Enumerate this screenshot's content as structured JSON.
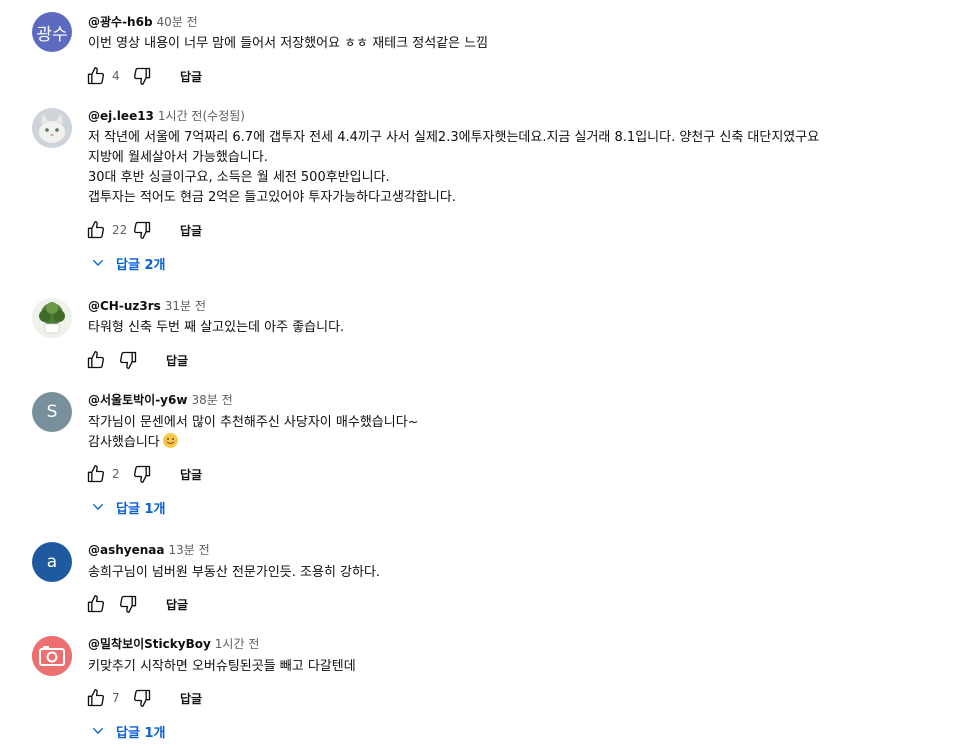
{
  "comments": [
    {
      "author": "@광수-h6b",
      "time": "40분 전",
      "avatar_text": "광수",
      "avatar_color": "#5c6bc0",
      "lines": [
        "이번 영상 내용이 너무 맘에 들어서 저장했어요 ㅎㅎ 재테크 정석같은 느낌"
      ],
      "likes": "4",
      "reply_label": "답글"
    },
    {
      "author": "@ej.lee13",
      "time": "1시간 전(수정됨)",
      "avatar_text": "",
      "avatar_color": "#d9dde3",
      "lines": [
        "저 작년에 서울에 7억짜리 6.7에 갭투자 전세 4.4끼구 사서 실제2.3에투자햇는데요.지금 실거래 8.1입니다. 양천구 신축 대단지였구요",
        "지방에 월세살아서 가능했습니다.",
        "30대 후반 싱글이구요, 소득은 월 세전 500후반입니다.",
        "갭투자는 적어도 현금 2억은 들고있어야 투자가능하다고생각합니다."
      ],
      "likes": "22",
      "reply_label": "답글",
      "view_replies": "답글 2개"
    },
    {
      "author": "@CH-uz3rs",
      "time": "31분 전",
      "avatar_text": "",
      "avatar_color": "#6b8e4e",
      "lines": [
        "타워형 신축 두번 째 살고있는데 아주 좋습니다."
      ],
      "likes": "",
      "reply_label": "답글"
    },
    {
      "author": "@서울토박이-y6w",
      "time": "38분 전",
      "avatar_text": "S",
      "avatar_color": "#78909c",
      "lines": [
        "작가님이 문센에서 많이 추천해주신 사당자이 매수했습니다~",
        "감사했습니다"
      ],
      "likes": "2",
      "reply_label": "답글",
      "view_replies": "답글 1개"
    },
    {
      "author": "@ashyenaa",
      "time": "13분 전",
      "avatar_text": "a",
      "avatar_color": "#1f5aa0",
      "lines": [
        "송희구님이 넘버원 부동산 전문가인듯. 조용히 강하다."
      ],
      "likes": "",
      "reply_label": "답글"
    },
    {
      "author": "@밀착보이StickyBoy",
      "time": "1시간 전",
      "avatar_text": "",
      "avatar_color": "#ee6f6f",
      "lines": [
        "키맞추기 시작하면 오버슈팅된곳들 빼고 다갈텐데"
      ],
      "likes": "7",
      "reply_label": "답글",
      "view_replies": "답글 1개"
    }
  ]
}
